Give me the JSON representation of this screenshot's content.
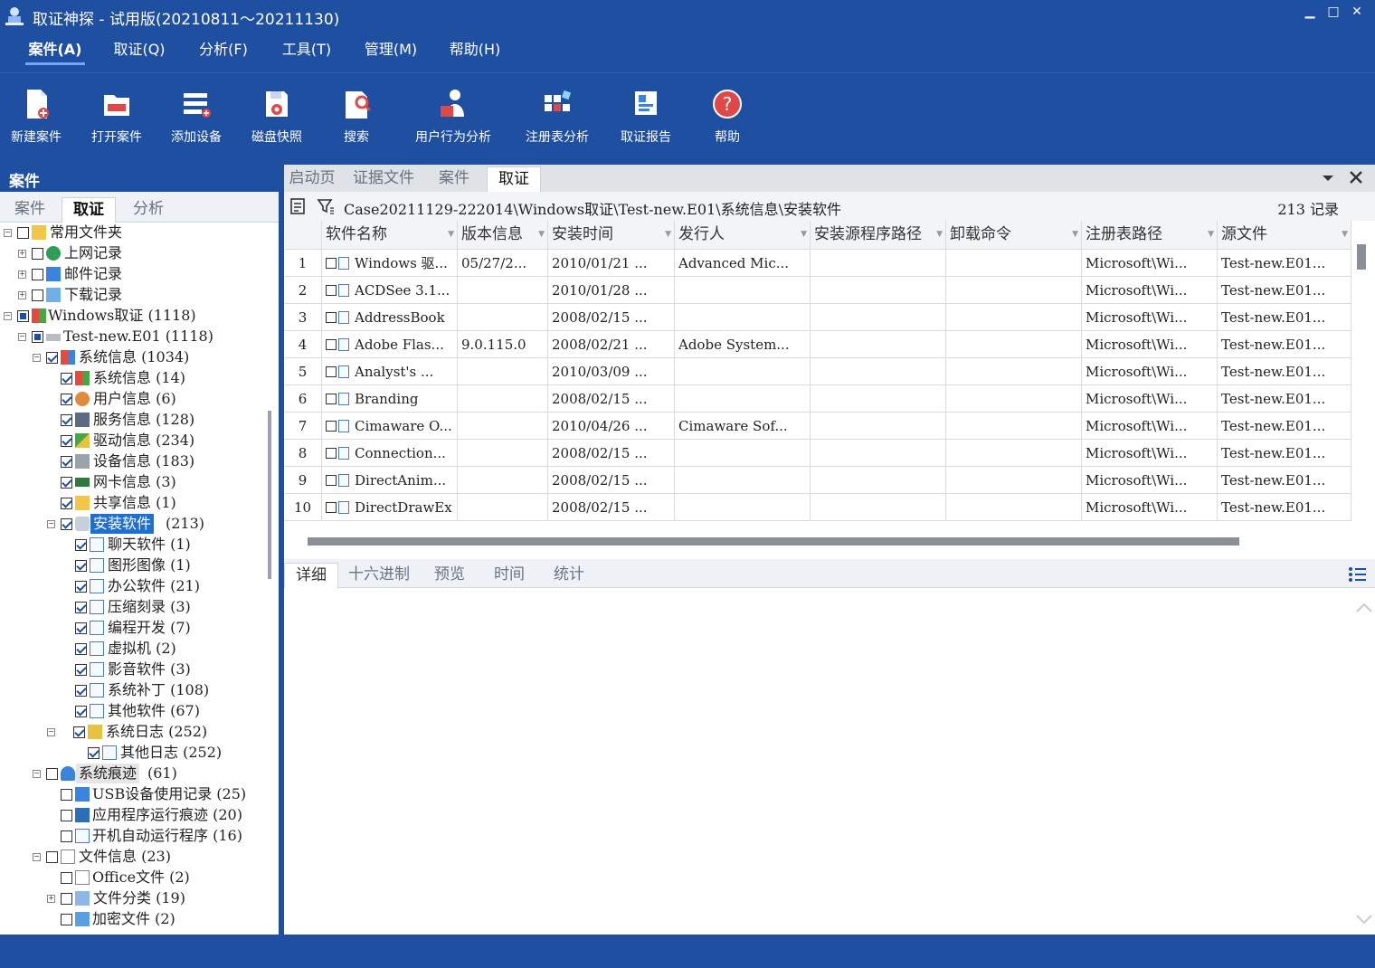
{
  "window": {
    "title": "取证神探 - 试用版(20210811～20211130)",
    "minimize": "▁",
    "maximize": "□",
    "close": "✕"
  },
  "menu": [
    "案件(A)",
    "取证(Q)",
    "分析(F)",
    "工具(T)",
    "管理(M)",
    "帮助(H)"
  ],
  "toolbar": [
    "新建案件",
    "打开案件",
    "添加设备",
    "磁盘快照",
    "搜索",
    "用户行为分析",
    "注册表分析",
    "取证报告",
    "帮助"
  ],
  "left": {
    "header": "案件",
    "tabs": [
      "案件",
      "取证",
      "分析"
    ],
    "tree": [
      "常用文件夹",
      "上网记录",
      "邮件记录",
      "下载记录",
      "Windows取证 (1118)",
      "Test-new.E01 (1118)",
      "系统信息 (1034)",
      "系统信息 (14)",
      "用户信息 (6)",
      "服务信息 (128)",
      "驱动信息 (234)",
      "设备信息 (183)",
      "网卡信息 (3)",
      "共享信息 (1)",
      "安装软件",
      "聊天软件 (1)",
      "图形图像 (1)",
      "办公软件 (21)",
      "压缩刻录 (3)",
      "编程开发 (7)",
      "虚拟机 (2)",
      "影音软件 (3)",
      "系统补丁 (108)",
      "其他软件 (67)",
      "系统日志 (252)",
      "其他日志 (252)",
      "系统痕迹",
      "USB设备使用记录 (25)",
      "应用程序运行痕迹 (20)",
      "开机自动运行程序 (16)",
      "文件信息 (23)",
      "Office文件 (2)",
      "文件分类 (19)",
      "加密文件 (2)"
    ],
    "tree_extra": {
      "install_count": "(213)",
      "trace_count": "(61)"
    }
  },
  "doctabs": [
    "启动页",
    "证据文件",
    "案件",
    "取证"
  ],
  "path": "Case20211129-222014\\Windows取证\\Test-new.E01\\系统信息\\安装软件",
  "record_count": "213 记录",
  "grid": {
    "headers": [
      "软件名称",
      "版本信息",
      "安装时间",
      "发行人",
      "安装源程序路径",
      "卸载命令",
      "注册表路径",
      "源文件"
    ],
    "rows": [
      [
        "1",
        "Windows 驱...",
        "05/27/2...",
        "2010/01/21 ...",
        "Advanced Mic...",
        "",
        "",
        "Microsoft\\Wi...",
        "Test-new.E01..."
      ],
      [
        "2",
        "ACDSee 3.1...",
        "",
        "2010/01/28 ...",
        "",
        "",
        "",
        "Microsoft\\Wi...",
        "Test-new.E01..."
      ],
      [
        "3",
        "AddressBook",
        "",
        "2008/02/15 ...",
        "",
        "",
        "",
        "Microsoft\\Wi...",
        "Test-new.E01..."
      ],
      [
        "4",
        "Adobe Flas...",
        "9.0.115.0",
        "2008/02/21 ...",
        "Adobe System...",
        "",
        "",
        "Microsoft\\Wi...",
        "Test-new.E01..."
      ],
      [
        "5",
        "Analyst's ...",
        "",
        "2010/03/09 ...",
        "",
        "",
        "",
        "Microsoft\\Wi...",
        "Test-new.E01..."
      ],
      [
        "6",
        "Branding",
        "",
        "2008/02/15 ...",
        "",
        "",
        "",
        "Microsoft\\Wi...",
        "Test-new.E01..."
      ],
      [
        "7",
        "Cimaware O...",
        "",
        "2010/04/26 ...",
        "Cimaware Sof...",
        "",
        "",
        "Microsoft\\Wi...",
        "Test-new.E01..."
      ],
      [
        "8",
        "Connection...",
        "",
        "2008/02/15 ...",
        "",
        "",
        "",
        "Microsoft\\Wi...",
        "Test-new.E01..."
      ],
      [
        "9",
        "DirectAnim...",
        "",
        "2008/02/15 ...",
        "",
        "",
        "",
        "Microsoft\\Wi...",
        "Test-new.E01..."
      ],
      [
        "10",
        "DirectDrawEx",
        "",
        "2008/02/15 ...",
        "",
        "",
        "",
        "Microsoft\\Wi...",
        "Test-new.E01..."
      ]
    ]
  },
  "bottomtabs": [
    "详细",
    "十六进制",
    "预览",
    "时间",
    "统计"
  ],
  "colors": {
    "primary": "#1f4fa0",
    "selection": "#1f6fd0"
  }
}
